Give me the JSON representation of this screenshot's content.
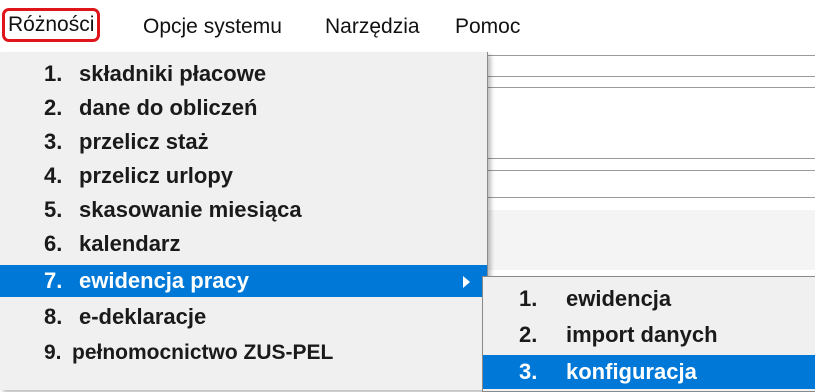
{
  "menubar": {
    "items": [
      {
        "label": "Różności"
      },
      {
        "label": "Opcje systemu"
      },
      {
        "label": "Narzędzia"
      },
      {
        "label": "Pomoc"
      }
    ]
  },
  "dropdown": {
    "items": [
      {
        "num": "1.",
        "label": "składniki płacowe"
      },
      {
        "num": "2.",
        "label": "dane do obliczeń"
      },
      {
        "num": "3.",
        "label": "przelicz staż"
      },
      {
        "num": "4.",
        "label": "przelicz urlopy"
      },
      {
        "num": "5.",
        "label": "skasowanie miesiąca"
      },
      {
        "num": "6.",
        "label": "kalendarz"
      },
      {
        "num": "7.",
        "label": "ewidencja pracy"
      },
      {
        "num": "8.",
        "label": "e-deklaracje"
      },
      {
        "num": "9.",
        "label": "pełnomocnictwo ZUS-PEL"
      }
    ],
    "highlighted_item": "ewidencja pracy"
  },
  "submenu": {
    "items": [
      {
        "num": "1.",
        "label": "ewidencja"
      },
      {
        "num": "2.",
        "label": "import danych"
      },
      {
        "num": "3.",
        "label": "konfiguracja"
      }
    ],
    "highlighted_item": "konfiguracja"
  },
  "colors": {
    "highlight": "#0078d7",
    "active_menu_border": "#e0151c",
    "menu_background": "#f0f0f0"
  },
  "icons": {
    "submenu_indicator": "chevron-right-icon"
  }
}
